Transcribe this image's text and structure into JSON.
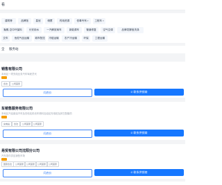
{
  "header": {
    "title": "看"
  },
  "filters": {
    "row1": [
      "建筑等",
      "品牌馆",
      "皇冠",
      "储蓄",
      "药用资源",
      "低毒专有",
      "工程车"
    ],
    "row2": [
      "聚氨-空中环保料",
      "长安用水",
      "一汽解放商车",
      "新能源车",
      "管道修复",
      "空气空调",
      "品牌发酵宝洗涤"
    ],
    "row3": [
      "交车",
      "危险气品运输",
      "城市配送",
      "冷链运输",
      "农产冷运输",
      "环保",
      "工程运输"
    ]
  },
  "tabs": [
    "全",
    "服务站"
  ],
  "companies": [
    {
      "name": "销售有限公司",
      "subtitle": "本地区一项充电业务汽车驾驶员代",
      "tags": [
        "合法",
        "公司首家"
      ],
      "consult_label": "问底价",
      "call_label": "联系供销商"
    },
    {
      "name": "车销售服务有限公司",
      "subtitle": "本地区汽油柴油汽车及充电站机动车燃料加油站充电桩及其它配套的",
      "tags": [
        "充电站",
        "合法",
        "公司首家",
        "公司首家"
      ],
      "consult_label": "问底价",
      "call_label": "联系供销商"
    },
    {
      "name": "易贸有限公司沈阳分公司",
      "subtitle": "汽车零件供应销售市场",
      "tags": [
        "国家合法",
        "公司首家",
        "公司首家",
        "公司首家",
        "公司首家"
      ],
      "consult_label": "问底价",
      "call_label": "联系供销商"
    }
  ],
  "colors": {
    "accent": "#1677ff",
    "badge": "#f59e0b"
  }
}
